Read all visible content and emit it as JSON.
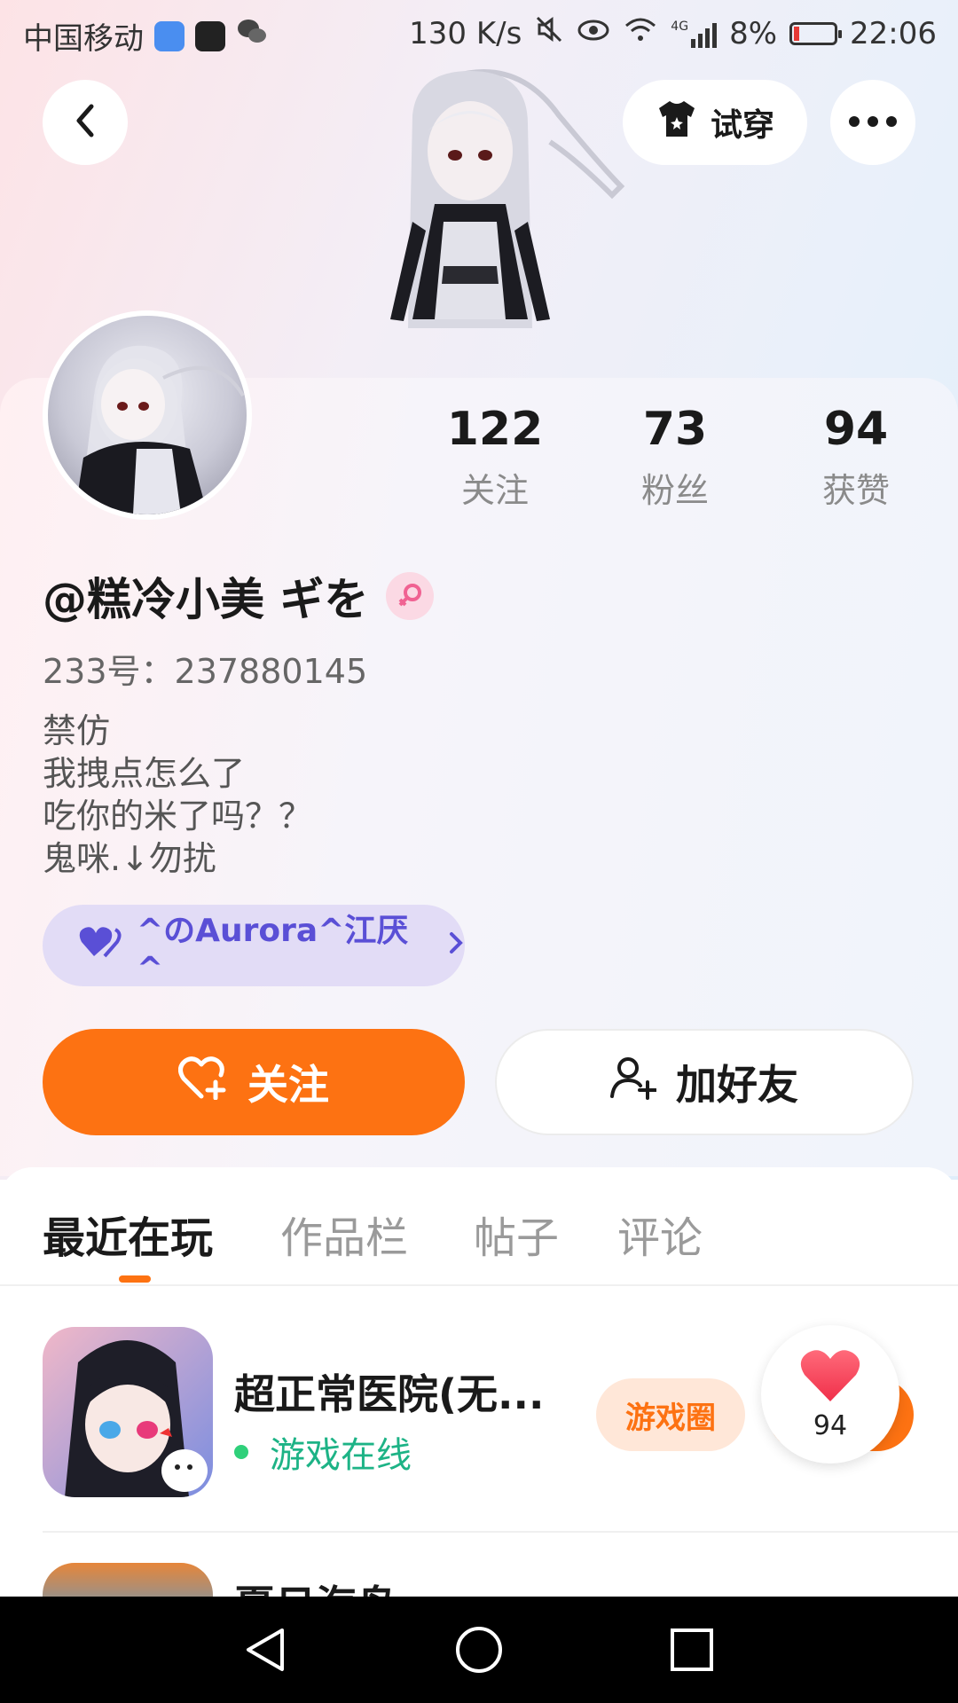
{
  "status_bar": {
    "carrier": "中国移动",
    "net_speed": "130 K/s",
    "network": "4G",
    "battery": "8%",
    "time": "22:06"
  },
  "top_bar": {
    "try_on_label": "试穿"
  },
  "stats": [
    {
      "value": "122",
      "label": "关注"
    },
    {
      "value": "73",
      "label": "粉丝"
    },
    {
      "value": "94",
      "label": "获赞"
    }
  ],
  "profile": {
    "nickname": "@糕冷小美 ギを",
    "uid": "233号：237880145",
    "bio": [
      "禁仿",
      "我拽点怎么了",
      "吃你的米了吗？？",
      "鬼咪.↓勿扰"
    ],
    "relation_tag": "^のAurora^江厌^"
  },
  "actions": {
    "follow_label": "关注",
    "add_friend_label": "加好友"
  },
  "tabs": [
    {
      "label": "最近在玩",
      "active": true
    },
    {
      "label": "作品栏",
      "active": false
    },
    {
      "label": "帖子",
      "active": false
    },
    {
      "label": "评论",
      "active": false
    }
  ],
  "games": [
    {
      "title": "超正常医院(无...",
      "status": "游戏在线",
      "circle_label": "游戏圈"
    },
    {
      "title": "夏日海岛"
    }
  ],
  "like_fab": {
    "count": "94"
  },
  "colors": {
    "accent": "#fd7212",
    "online": "#1db386",
    "tag_bg": "#e2dcf6",
    "tag_text": "#5a4fd6"
  }
}
